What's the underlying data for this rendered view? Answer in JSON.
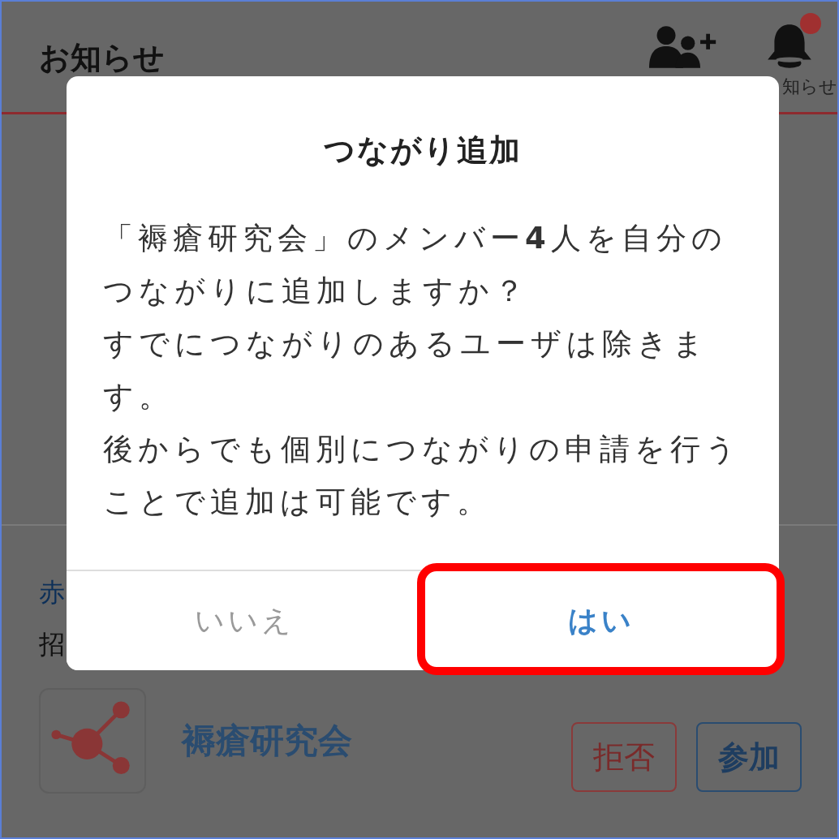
{
  "header": {
    "title": "お知らせ",
    "notification_label": "知らせ",
    "has_unread": true
  },
  "background_item": {
    "link_fragment": "赤",
    "text_fragment": "招",
    "group": {
      "name": "褥瘡研究会"
    },
    "buttons": [
      {
        "label": "拒否",
        "kind": "reject"
      },
      {
        "label": "参加",
        "kind": "join"
      }
    ]
  },
  "dialog": {
    "title": "つながり追加",
    "message": [
      "「褥瘡研究会」のメンバー**4**人を自分のつながりに追加しますか？",
      "すでにつながりのあるユーザは除きます。",
      "後からでも個別につながりの申請を行うことで追加は可能です。"
    ],
    "buttons": [
      {
        "label": "いいえ",
        "kind": "cancel",
        "highlighted": false
      },
      {
        "label": "はい",
        "kind": "confirm",
        "highlighted": true
      }
    ]
  }
}
